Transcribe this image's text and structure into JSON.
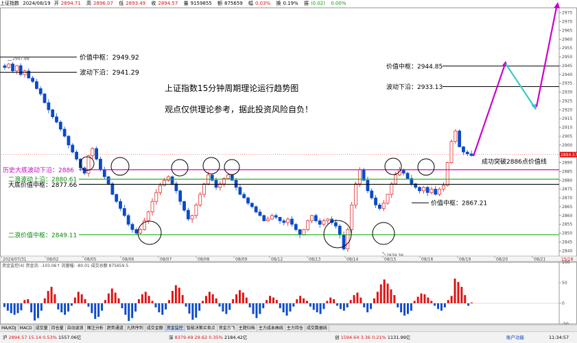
{
  "header": {
    "symbol": "上证指数",
    "date": "2024/08/19",
    "open_lbl": "开",
    "open": "2894.71",
    "high_lbl": "高",
    "high": "2896.07",
    "low_lbl": "低",
    "low": "2893.49",
    "close_lbl": "收",
    "close": "2894.57",
    "volume_lbl": "量",
    "volume": "9159855",
    "amount_lbl": "额",
    "amount": "875659",
    "change_lbl": "幅",
    "change": "0.03%",
    "turnover_lbl": "换",
    "turnover": "0.19%",
    "amp_lbl": "振",
    "amp": "(0.02)",
    "amp_pct": "0.00%"
  },
  "colors": {
    "up": "#e01010",
    "down": "#0a4ac8",
    "magenta": "#cc00cc",
    "green_line": "#19b319",
    "cyan": "#33cccc",
    "level": "#000000"
  },
  "chart_data": [
    {
      "type": "candlestick",
      "title": "上证指数15分钟周期理论运行趋势图",
      "subtitle": "观点仅供理论参考，据此投资风险自负！",
      "y_ticks": [
        2840,
        2845,
        2850,
        2855,
        2860,
        2865,
        2870,
        2875,
        2880,
        2885,
        2890,
        2895,
        2900,
        2905,
        2910,
        2915,
        2920,
        2925,
        2930,
        2935,
        2940,
        2945,
        2950,
        2955,
        2960,
        2965,
        2970,
        2975
      ],
      "ylim": [
        2837,
        2978
      ],
      "date_labels": [
        "2024/07/31",
        "08/02",
        "08/05",
        "08/06",
        "08/07",
        "08/08",
        "08/09",
        "08/12",
        "08/13",
        "08/14",
        "08/15",
        "08/16",
        "08/19",
        "08/20",
        "08/21"
      ],
      "high_marker": "2947.88",
      "low_marker": "2839.39",
      "current_price": "2894.57",
      "last_time": "15/18",
      "path": [
        2945,
        2944,
        2946,
        2942,
        2945,
        2940,
        2942,
        2938,
        2936,
        2932,
        2929,
        2924,
        2920,
        2916,
        2913,
        2909,
        2905,
        2900,
        2896,
        2892,
        2887,
        2884,
        2894,
        2898,
        2892,
        2886,
        2882,
        2878,
        2872,
        2868,
        2864,
        2860,
        2855,
        2852,
        2850,
        2852,
        2857,
        2862,
        2868,
        2873,
        2877,
        2880,
        2882,
        2878,
        2874,
        2868,
        2863,
        2858,
        2860,
        2866,
        2872,
        2878,
        2883,
        2880,
        2876,
        2878,
        2881,
        2883,
        2880,
        2876,
        2872,
        2870,
        2867,
        2865,
        2862,
        2860,
        2857,
        2858,
        2860,
        2859,
        2857,
        2856,
        2858,
        2855,
        2852,
        2849,
        2852,
        2857,
        2860,
        2857,
        2855,
        2857,
        2858,
        2856,
        2854,
        2849,
        2841,
        2852,
        2866,
        2878,
        2886,
        2880,
        2874,
        2870,
        2866,
        2864,
        2867,
        2872,
        2878,
        2883,
        2886,
        2884,
        2881,
        2878,
        2876,
        2874,
        2876,
        2873,
        2875,
        2872,
        2875,
        2877,
        2890,
        2902,
        2908,
        2899,
        2896,
        2895,
        2894
      ]
    },
    {
      "type": "bar",
      "title": "资金监控(4) 资金流: -103.06↑ 流量幅: -80.01 成交总额 875659.5",
      "y_ticks": [
        100,
        50,
        0,
        -50,
        -100
      ],
      "ylim": [
        -110,
        110
      ],
      "x": [
        1,
        2,
        3,
        4,
        5,
        6,
        7,
        8,
        9,
        10,
        11,
        12,
        13,
        14,
        15,
        16,
        17,
        18,
        19,
        20,
        21,
        22,
        23,
        24,
        25,
        26,
        27,
        28,
        29,
        30,
        31,
        32,
        33,
        34,
        35,
        36,
        37,
        38,
        39,
        40,
        41,
        42,
        43,
        44,
        45,
        46,
        47,
        48,
        49,
        50,
        51,
        52,
        53,
        54,
        55,
        56,
        57,
        58,
        59,
        60,
        61,
        62,
        63,
        64,
        65,
        66,
        67,
        68,
        69,
        70,
        71,
        72,
        73,
        74,
        75,
        76,
        77,
        78,
        79,
        80,
        81,
        82,
        83,
        84,
        85,
        86,
        87,
        88,
        89,
        90,
        91,
        92,
        93,
        94,
        95,
        96,
        97,
        98,
        99,
        100,
        101,
        102,
        103,
        104,
        105,
        106,
        107,
        108,
        109,
        110,
        111,
        112,
        113,
        114,
        115,
        116,
        117,
        118,
        119,
        120,
        121,
        122,
        123,
        124,
        125,
        126,
        127,
        128,
        129,
        130,
        131,
        132,
        133,
        134,
        135,
        136,
        137,
        138,
        139,
        140
      ],
      "values": [
        -9,
        -18,
        -24,
        -28,
        -24,
        -17,
        8,
        10,
        -22,
        -42,
        -36,
        -18,
        12,
        30,
        40,
        22,
        -15,
        -22,
        -28,
        -20,
        -6,
        14,
        28,
        22,
        10,
        -8,
        -24,
        -38,
        -33,
        -18,
        8,
        24,
        36,
        26,
        12,
        -12,
        -28,
        -43,
        -36,
        -20,
        10,
        22,
        28,
        18,
        6,
        -10,
        -22,
        -28,
        -15,
        8,
        30,
        44,
        38,
        20,
        -8,
        -25,
        -40,
        -35,
        -18,
        6,
        18,
        28,
        22,
        12,
        -8,
        -20,
        -26,
        -16,
        10,
        22,
        32,
        26,
        14,
        -10,
        -26,
        -36,
        -26,
        -12,
        8,
        18,
        14,
        8,
        -12,
        -22,
        -30,
        -20,
        -8,
        10,
        18,
        12,
        6,
        -8,
        -16,
        -22,
        -26,
        -14,
        6,
        14,
        10,
        -6,
        -14,
        -18,
        -10,
        8,
        20,
        26,
        14,
        -10,
        -22,
        -14,
        12,
        28,
        46,
        58,
        48,
        34,
        20,
        -10,
        -22,
        -30,
        -26,
        -18,
        6,
        16,
        24,
        22,
        14,
        6,
        -6,
        -14,
        -18,
        -10,
        8,
        18,
        60,
        52,
        40,
        20,
        -6,
        2
      ]
    }
  ],
  "annotations": {
    "levels": [
      {
        "label": "价值中枢：2949.92",
        "value": 2949.92
      },
      {
        "label": "波动下沿：2941.29",
        "value": 2941.29
      },
      {
        "label": "历史大底波动下沿：2886",
        "value": 2886
      },
      {
        "label": "二浪波动上沿：2880.61",
        "value": 2880.61
      },
      {
        "label": "大底价值中枢：2877.66",
        "value": 2877.66
      },
      {
        "label": "二浪价值中枢：2849.11",
        "value": 2849.11
      },
      {
        "label": "价值中枢：2867.21",
        "value": 2867.21
      },
      {
        "label": "价值中枢：2944.85",
        "value": 2944.85
      },
      {
        "label": "波动下沿：2933.13",
        "value": 2933.13
      }
    ],
    "breakout": "成功突破2886点价值线"
  },
  "tabs": [
    "MA/KDJ",
    "MACD",
    "成交量",
    "持仓量",
    "自动波浪",
    "赌注分析",
    "趋势通道",
    "九转序列",
    "成交金额",
    "资金监控",
    "智能决策买卖点",
    "资金方飞",
    "主题归档",
    "主力成本曲线",
    "主力持仓",
    "成交数据线"
  ],
  "active_tab": "资金监控",
  "status": {
    "i1_name": "沪",
    "i1_price": "2894.57",
    "i1_chg": "15.14",
    "i1_pct": "0.53%",
    "i1_amt": "1557.06亿",
    "i2_name": "深",
    "i2_price": "8379.49",
    "i2_chg": "29.62",
    "i2_pct": "0.35%",
    "i2_amt": "2184.42亿",
    "i3_name": "创",
    "i3_price": "1594.64",
    "i3_chg": "3.36",
    "i3_pct": "0.21%",
    "i3_amt": "1131.99亿",
    "right_text": "账户功能",
    "time": "11:34:57"
  }
}
